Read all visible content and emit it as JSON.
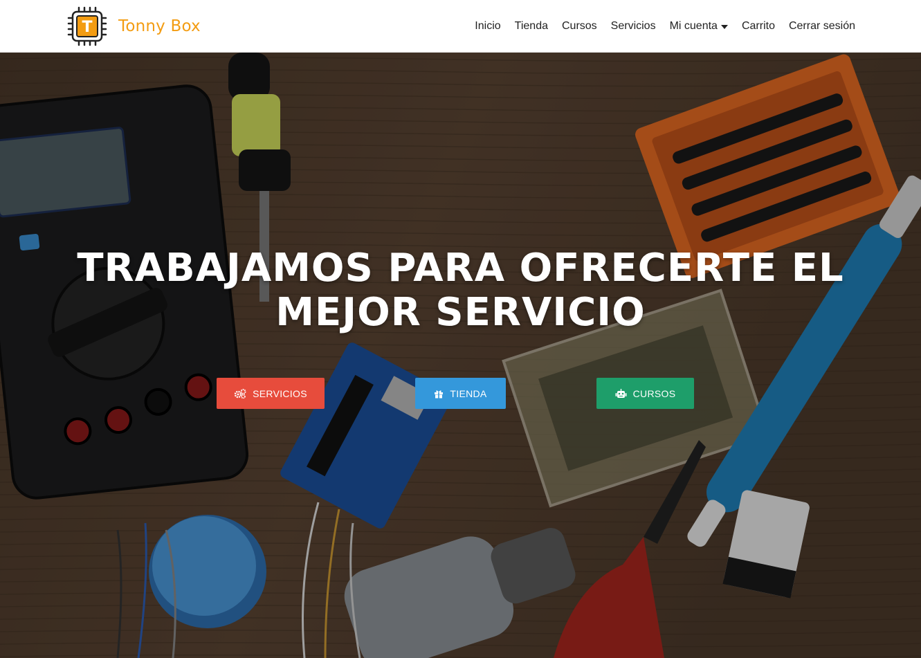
{
  "brand": {
    "name": "Tonny Box",
    "logo_letter": "T"
  },
  "nav": {
    "items": [
      {
        "label": "Inicio"
      },
      {
        "label": "Tienda"
      },
      {
        "label": "Cursos"
      },
      {
        "label": "Servicios"
      },
      {
        "label": "Mi cuenta",
        "dropdown": true
      },
      {
        "label": "Carrito"
      },
      {
        "label": "Cerrar sesión"
      }
    ]
  },
  "hero": {
    "headline_line1": "TRABAJAMOS PARA OFRECERTE EL",
    "headline_line2": "MEJOR SERVICIO",
    "buttons": {
      "servicios": {
        "label": "SERVICIOS",
        "icon": "gears-icon",
        "color": "#e74c3c"
      },
      "tienda": {
        "label": "TIENDA",
        "icon": "gift-icon",
        "color": "#3498db"
      },
      "cursos": {
        "label": "CURSOS",
        "icon": "robot-icon",
        "color": "#1e9e6a"
      }
    }
  },
  "colors": {
    "brand": "#f39c12"
  }
}
